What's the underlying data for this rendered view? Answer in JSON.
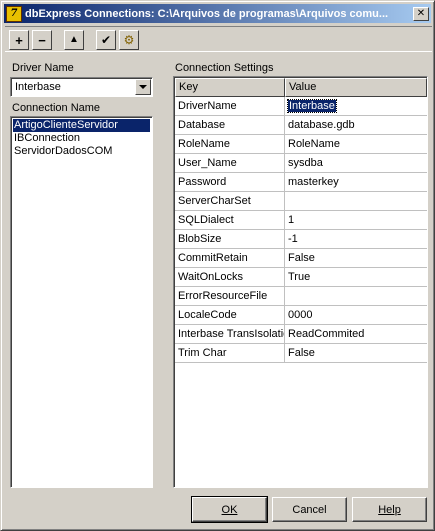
{
  "window": {
    "title": "dbExpress Connections: C:\\Arquivos de programas\\Arquivos comu...",
    "app_icon": "delphi-icon",
    "close_glyph": "✕"
  },
  "toolbar": {
    "add": {
      "glyph": "+",
      "icon": "plus-icon"
    },
    "delete": {
      "glyph": "−",
      "icon": "minus-icon"
    },
    "rename": {
      "glyph": "▲",
      "icon": "up-arrow-icon"
    },
    "test": {
      "glyph": "✔",
      "icon": "check-icon"
    },
    "settings": {
      "glyph": "⚙",
      "icon": "gear-icon"
    }
  },
  "driver": {
    "label": "Driver Name",
    "value": "Interbase"
  },
  "connections": {
    "label": "Connection Name",
    "items": [
      "ArtigoClienteServidor",
      "IBConnection",
      "ServidorDadosCOM"
    ],
    "selected_index": 0
  },
  "settings": {
    "label": "Connection Settings",
    "columns": [
      "Key",
      "Value"
    ],
    "rows": [
      {
        "key": "DriverName",
        "value": "Interbase"
      },
      {
        "key": "Database",
        "value": "database.gdb"
      },
      {
        "key": "RoleName",
        "value": "RoleName"
      },
      {
        "key": "User_Name",
        "value": "sysdba"
      },
      {
        "key": "Password",
        "value": "masterkey"
      },
      {
        "key": "ServerCharSet",
        "value": ""
      },
      {
        "key": "SQLDialect",
        "value": "1"
      },
      {
        "key": "BlobSize",
        "value": "-1"
      },
      {
        "key": "CommitRetain",
        "value": "False"
      },
      {
        "key": "WaitOnLocks",
        "value": "True"
      },
      {
        "key": "ErrorResourceFile",
        "value": ""
      },
      {
        "key": "LocaleCode",
        "value": "0000"
      },
      {
        "key": "Interbase TransIsolation",
        "value": "ReadCommited"
      },
      {
        "key": "Trim Char",
        "value": "False"
      }
    ]
  },
  "buttons": {
    "ok": "OK",
    "cancel": "Cancel",
    "help": "Help"
  },
  "colors": {
    "titlebar_start": "#0a246a",
    "titlebar_end": "#a6caf0",
    "selection": "#0a246a",
    "face": "#d4d0c8"
  }
}
